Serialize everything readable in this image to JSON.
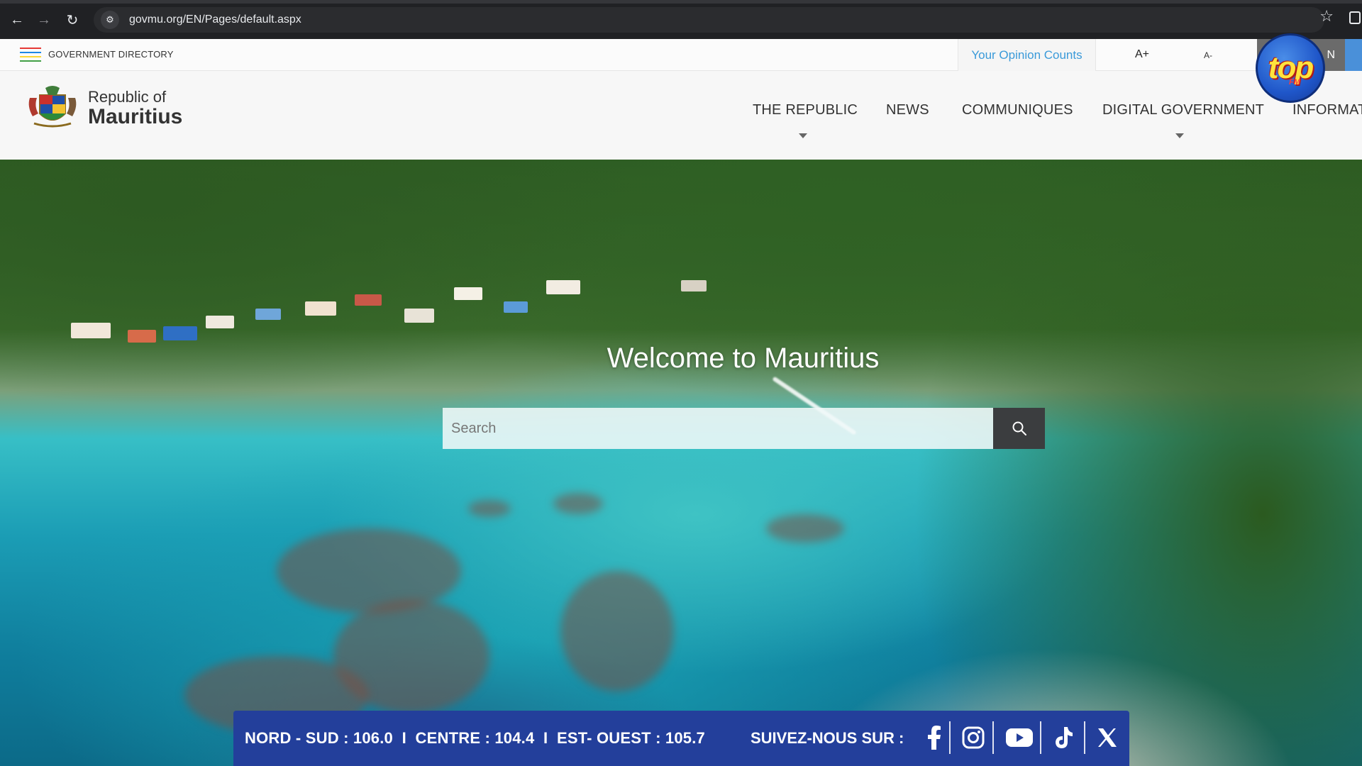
{
  "browser": {
    "url": "govmu.org/EN/Pages/default.aspx"
  },
  "utility_bar": {
    "government_directory": "GOVERNMENT DIRECTORY",
    "opinion_link": "Your Opinion Counts",
    "font_increase": "A+",
    "font_decrease": "A-",
    "language": "N"
  },
  "brand": {
    "line1": "Republic of",
    "line2": "Mauritius"
  },
  "menu": [
    {
      "label": "THE REPUBLIC",
      "has_dropdown": true
    },
    {
      "label": "NEWS",
      "has_dropdown": false
    },
    {
      "label": "COMMUNIQUES",
      "has_dropdown": false
    },
    {
      "label": "DIGITAL GOVERNMENT",
      "has_dropdown": true
    },
    {
      "label": "INFORMAT",
      "has_dropdown": false
    }
  ],
  "hero": {
    "title": "Welcome to Mauritius",
    "search_placeholder": "Search"
  },
  "overlay": {
    "logo_text": "top",
    "logo_sub": "FM",
    "frequencies": "NORD - SUD : 106.0  I  CENTRE : 104.4  I  EST- OUEST : 105.7",
    "follow_label": "SUIVEZ-NOUS SUR :",
    "socials": [
      "facebook-icon",
      "instagram-icon",
      "youtube-icon",
      "tiktok-icon",
      "x-icon"
    ]
  },
  "colors": {
    "accent_blue": "#3a9ad9",
    "banner_blue": "#233f9b",
    "hamburger": [
      "#e53935",
      "#1e88e5",
      "#fdd835",
      "#43a047"
    ]
  }
}
